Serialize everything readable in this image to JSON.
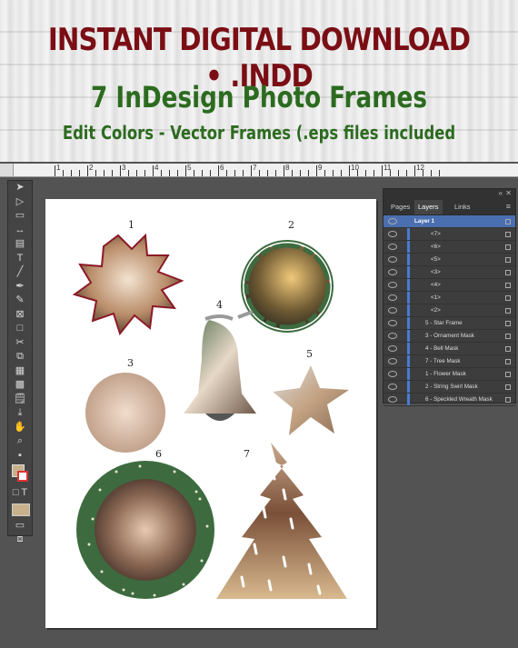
{
  "banner": {
    "line1": "INSTANT DIGITAL DOWNLOAD • .INDD",
    "line2": "7 InDesign Photo Frames",
    "line3": "Edit Colors - Vector Frames (.eps files included"
  },
  "ruler": {
    "numbers": [
      "1",
      "2",
      "3",
      "4",
      "5",
      "6",
      "7",
      "8",
      "9",
      "10",
      "11",
      "12"
    ]
  },
  "colors": {
    "banner_red": "#7a0e14",
    "banner_green": "#2c6b1f",
    "frame_green": "#3d6b3f",
    "layer_highlight": "#4a7bd0"
  },
  "canvas": {
    "frame_labels": [
      "1",
      "2",
      "3",
      "4",
      "5",
      "6",
      "7"
    ]
  },
  "panel": {
    "tabs": [
      "Pages",
      "Layers",
      "Links"
    ],
    "layer_name": "Layer 1",
    "rows": [
      "<7>",
      "<6>",
      "<5>",
      "<3>",
      "<4>",
      "<1>",
      "<2>",
      "5 - Star Frame",
      "3 - Ornament Mask",
      "4 - Bell Mask",
      "7 - Tree Mask",
      "1 - Flower Mask",
      "2 - String Swirl  Mask",
      "6 - Speckled Wreath Mask"
    ]
  }
}
